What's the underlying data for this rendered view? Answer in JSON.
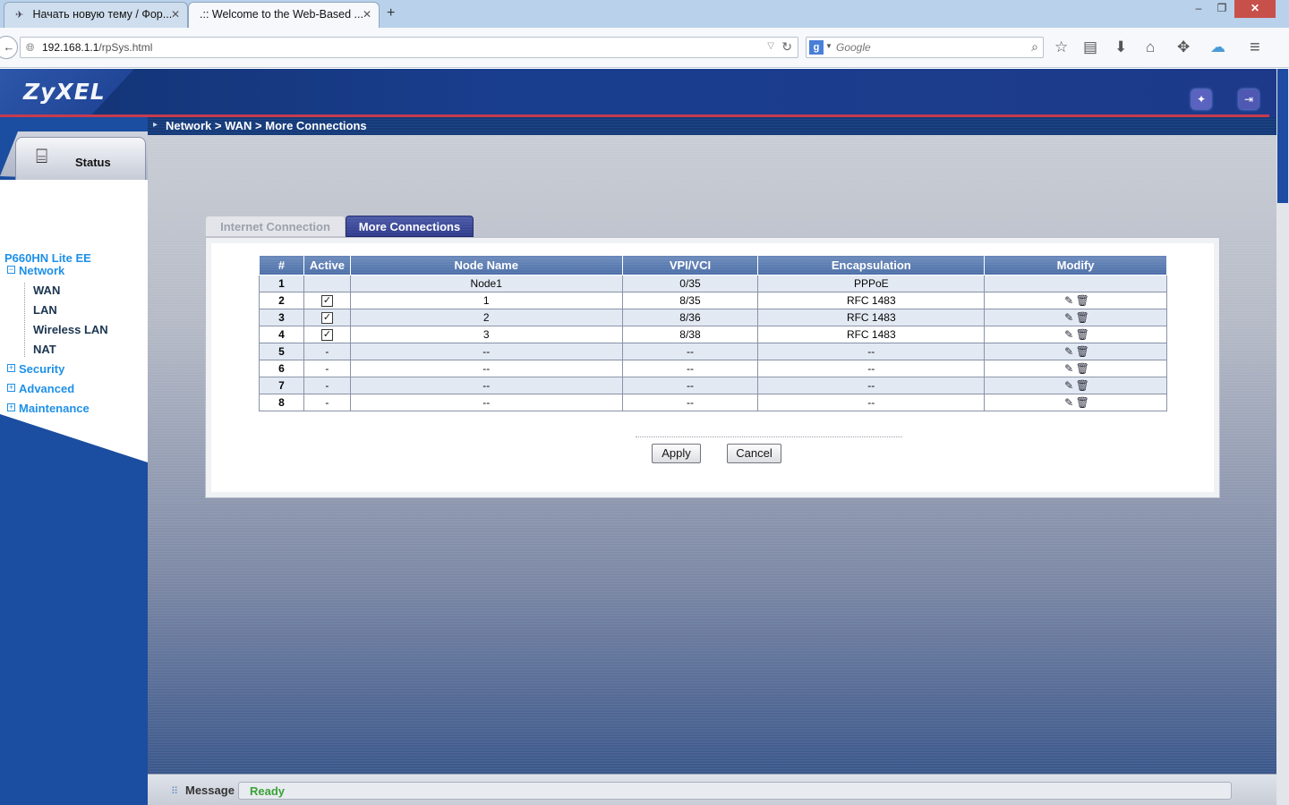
{
  "browser": {
    "tabs": [
      {
        "title": "Начать новую тему / Фор...",
        "close": "✕"
      },
      {
        "title": ".:: Welcome to the Web-Based ...",
        "close": "✕"
      }
    ],
    "new_tab": "+",
    "window": {
      "minimize": "–",
      "restore": "❐",
      "close": "✕"
    },
    "url": {
      "host": "192.168.1.1",
      "path": "/rpSys.html"
    },
    "search": {
      "engine": "g",
      "placeholder": "Google"
    }
  },
  "router": {
    "brand": "ZyXEL",
    "breadcrumb": "Network > WAN > More Connections",
    "sidebar": {
      "status_label": "Status",
      "model": "P660HN Lite EE",
      "items": [
        {
          "label": "Network",
          "expanded": true
        },
        {
          "label": "WAN"
        },
        {
          "label": "LAN"
        },
        {
          "label": "Wireless LAN"
        },
        {
          "label": "NAT"
        },
        {
          "label": "Security",
          "expanded": false
        },
        {
          "label": "Advanced",
          "expanded": false
        },
        {
          "label": "Maintenance",
          "expanded": false
        }
      ],
      "expand_symbol": "+",
      "collapse_symbol": "−"
    },
    "tabs": {
      "internet": "Internet Connection",
      "more": "More Connections",
      "active": "More Connections"
    },
    "table": {
      "headers": [
        "#",
        "Active",
        "Node Name",
        "VPI/VCI",
        "Encapsulation",
        "Modify"
      ],
      "rows": [
        {
          "num": "1",
          "active": "",
          "node": "Node1",
          "vpivci": "0/35",
          "encap": "PPPoE",
          "modify": false
        },
        {
          "num": "2",
          "active": "checked",
          "node": "1",
          "vpivci": "8/35",
          "encap": "RFC 1483",
          "modify": true
        },
        {
          "num": "3",
          "active": "checked",
          "node": "2",
          "vpivci": "8/36",
          "encap": "RFC 1483",
          "modify": true
        },
        {
          "num": "4",
          "active": "checked",
          "node": "3",
          "vpivci": "8/38",
          "encap": "RFC 1483",
          "modify": true
        },
        {
          "num": "5",
          "active": "-",
          "node": "--",
          "vpivci": "--",
          "encap": "--",
          "modify": true
        },
        {
          "num": "6",
          "active": "-",
          "node": "--",
          "vpivci": "--",
          "encap": "--",
          "modify": true
        },
        {
          "num": "7",
          "active": "-",
          "node": "--",
          "vpivci": "--",
          "encap": "--",
          "modify": true
        },
        {
          "num": "8",
          "active": "-",
          "node": "--",
          "vpivci": "--",
          "encap": "--",
          "modify": true
        }
      ]
    },
    "buttons": {
      "apply": "Apply",
      "cancel": "Cancel"
    },
    "message": {
      "label": "Message",
      "status": "Ready"
    },
    "colors": {
      "header": "#1a3e8e",
      "accent_red": "#c63b4f",
      "menu_link": "#1e90e8",
      "status_ready": "#3aa335"
    }
  }
}
